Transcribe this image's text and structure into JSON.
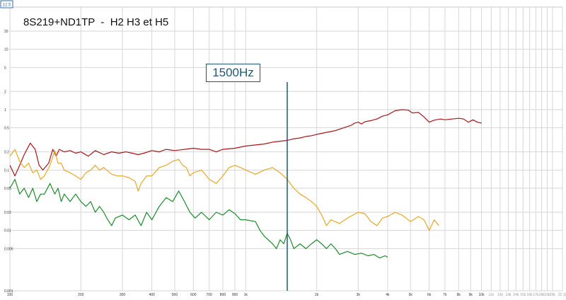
{
  "chart_data": {
    "type": "line",
    "title": "8S219+ND1TP  -  H2 H3 et H5",
    "xlabel": "",
    "ylabel": "",
    "x_scale": "log",
    "y_scale": "log",
    "xlim": [
      100,
      22050
    ],
    "ylim": [
      0.001,
      50
    ],
    "corner_label": "12.5",
    "x_ticks": [
      {
        "v": 100,
        "t": "100"
      },
      {
        "v": 200,
        "t": "200"
      },
      {
        "v": 300,
        "t": "300"
      },
      {
        "v": 400,
        "t": "400"
      },
      {
        "v": 500,
        "t": "500"
      },
      {
        "v": 600,
        "t": "600"
      },
      {
        "v": 700,
        "t": "700"
      },
      {
        "v": 800,
        "t": "800"
      },
      {
        "v": 900,
        "t": "900"
      },
      {
        "v": 1000,
        "t": "1k"
      },
      {
        "v": 2000,
        "t": "2k"
      },
      {
        "v": 3000,
        "t": "3k"
      },
      {
        "v": 4000,
        "t": "4k"
      },
      {
        "v": 5000,
        "t": "5k"
      },
      {
        "v": 6000,
        "t": "6k"
      },
      {
        "v": 7000,
        "t": "7k"
      },
      {
        "v": 8000,
        "t": "8k"
      },
      {
        "v": 9000,
        "t": "9k"
      },
      {
        "v": 10000,
        "t": "10k"
      },
      {
        "v": 11000,
        "t": "11k"
      },
      {
        "v": 12000,
        "t": "12k"
      },
      {
        "v": 13000,
        "t": "13k"
      },
      {
        "v": 14000,
        "t": "14k"
      },
      {
        "v": 15000,
        "t": "15k"
      },
      {
        "v": 16000,
        "t": "16k"
      },
      {
        "v": 17000,
        "t": "17k"
      },
      {
        "v": 18000,
        "t": "18k"
      },
      {
        "v": 19000,
        "t": "19k"
      },
      {
        "v": 20000,
        "t": "20k"
      },
      {
        "v": 22050,
        "t": "22.1k"
      }
    ],
    "y_ticks": [
      {
        "v": 20,
        "t": "20"
      },
      {
        "v": 10,
        "t": "10"
      },
      {
        "v": 5,
        "t": "5"
      },
      {
        "v": 2,
        "t": "2"
      },
      {
        "v": 1,
        "t": "1"
      },
      {
        "v": 0.5,
        "t": "0.5"
      },
      {
        "v": 0.2,
        "t": "0.2"
      },
      {
        "v": 0.1,
        "t": "0.1"
      },
      {
        "v": 0.05,
        "t": "0.05"
      },
      {
        "v": 0.02,
        "t": "0.02"
      },
      {
        "v": 0.01,
        "t": "0.01"
      },
      {
        "v": 0.005,
        "t": "0.005"
      },
      {
        "v": 0.001,
        "t": "0.001"
      }
    ],
    "grid": true,
    "annotation": {
      "label": "1500Hz",
      "x": 1500
    },
    "series": [
      {
        "color": "#a8161c",
        "points": [
          [
            100,
            0.12
          ],
          [
            105,
            0.08
          ],
          [
            110,
            0.12
          ],
          [
            115,
            0.18
          ],
          [
            122,
            0.28
          ],
          [
            128,
            0.22
          ],
          [
            133,
            0.12
          ],
          [
            138,
            0.1
          ],
          [
            146,
            0.13
          ],
          [
            152,
            0.22
          ],
          [
            157,
            0.17
          ],
          [
            162,
            0.22
          ],
          [
            170,
            0.2
          ],
          [
            180,
            0.21
          ],
          [
            190,
            0.19
          ],
          [
            200,
            0.2
          ],
          [
            215,
            0.17
          ],
          [
            230,
            0.21
          ],
          [
            250,
            0.18
          ],
          [
            270,
            0.2
          ],
          [
            290,
            0.19
          ],
          [
            310,
            0.2
          ],
          [
            330,
            0.19
          ],
          [
            350,
            0.18
          ],
          [
            370,
            0.19
          ],
          [
            400,
            0.21
          ],
          [
            430,
            0.2
          ],
          [
            460,
            0.22
          ],
          [
            500,
            0.21
          ],
          [
            550,
            0.22
          ],
          [
            600,
            0.23
          ],
          [
            650,
            0.22
          ],
          [
            700,
            0.22
          ],
          [
            750,
            0.2
          ],
          [
            800,
            0.22
          ],
          [
            900,
            0.23
          ],
          [
            1000,
            0.25
          ],
          [
            1100,
            0.26
          ],
          [
            1200,
            0.27
          ],
          [
            1300,
            0.29
          ],
          [
            1400,
            0.3
          ],
          [
            1500,
            0.31
          ],
          [
            1600,
            0.33
          ],
          [
            1700,
            0.34
          ],
          [
            1800,
            0.36
          ],
          [
            1900,
            0.37
          ],
          [
            2000,
            0.39
          ],
          [
            2200,
            0.42
          ],
          [
            2400,
            0.45
          ],
          [
            2600,
            0.5
          ],
          [
            2800,
            0.55
          ],
          [
            2900,
            0.6
          ],
          [
            3000,
            0.62
          ],
          [
            3100,
            0.58
          ],
          [
            3200,
            0.63
          ],
          [
            3400,
            0.66
          ],
          [
            3600,
            0.7
          ],
          [
            3800,
            0.78
          ],
          [
            4000,
            0.82
          ],
          [
            4300,
            0.96
          ],
          [
            4600,
            1.0
          ],
          [
            4900,
            0.98
          ],
          [
            5100,
            0.88
          ],
          [
            5400,
            0.9
          ],
          [
            5700,
            0.76
          ],
          [
            6000,
            0.62
          ],
          [
            6300,
            0.67
          ],
          [
            6700,
            0.7
          ],
          [
            7000,
            0.68
          ],
          [
            7500,
            0.7
          ],
          [
            8000,
            0.72
          ],
          [
            8400,
            0.7
          ],
          [
            8800,
            0.62
          ],
          [
            9200,
            0.68
          ],
          [
            9600,
            0.62
          ],
          [
            10000,
            0.6
          ]
        ]
      },
      {
        "color": "#e6a92c",
        "points": [
          [
            100,
            0.17
          ],
          [
            105,
            0.22
          ],
          [
            110,
            0.14
          ],
          [
            115,
            0.11
          ],
          [
            120,
            0.13
          ],
          [
            125,
            0.09
          ],
          [
            130,
            0.1
          ],
          [
            135,
            0.07
          ],
          [
            140,
            0.08
          ],
          [
            148,
            0.12
          ],
          [
            155,
            0.21
          ],
          [
            160,
            0.13
          ],
          [
            165,
            0.13
          ],
          [
            170,
            0.1
          ],
          [
            180,
            0.09
          ],
          [
            190,
            0.08
          ],
          [
            200,
            0.07
          ],
          [
            210,
            0.09
          ],
          [
            220,
            0.1
          ],
          [
            230,
            0.12
          ],
          [
            240,
            0.1
          ],
          [
            250,
            0.11
          ],
          [
            270,
            0.085
          ],
          [
            285,
            0.08
          ],
          [
            300,
            0.08
          ],
          [
            320,
            0.075
          ],
          [
            340,
            0.065
          ],
          [
            350,
            0.045
          ],
          [
            360,
            0.06
          ],
          [
            380,
            0.08
          ],
          [
            400,
            0.08
          ],
          [
            430,
            0.11
          ],
          [
            460,
            0.12
          ],
          [
            490,
            0.14
          ],
          [
            520,
            0.15
          ],
          [
            540,
            0.12
          ],
          [
            560,
            0.11
          ],
          [
            580,
            0.08
          ],
          [
            600,
            0.09
          ],
          [
            650,
            0.1
          ],
          [
            700,
            0.07
          ],
          [
            750,
            0.06
          ],
          [
            800,
            0.08
          ],
          [
            850,
            0.11
          ],
          [
            900,
            0.12
          ],
          [
            950,
            0.11
          ],
          [
            1000,
            0.1
          ],
          [
            1100,
            0.085
          ],
          [
            1200,
            0.1
          ],
          [
            1300,
            0.11
          ],
          [
            1400,
            0.09
          ],
          [
            1500,
            0.07
          ],
          [
            1600,
            0.05
          ],
          [
            1700,
            0.04
          ],
          [
            1800,
            0.035
          ],
          [
            1900,
            0.03
          ],
          [
            2000,
            0.025
          ],
          [
            2100,
            0.018
          ],
          [
            2200,
            0.012
          ],
          [
            2300,
            0.015
          ],
          [
            2500,
            0.013
          ],
          [
            2700,
            0.016
          ],
          [
            3000,
            0.02
          ],
          [
            3200,
            0.019
          ],
          [
            3400,
            0.014
          ],
          [
            3600,
            0.012
          ],
          [
            3800,
            0.016
          ],
          [
            4000,
            0.017
          ],
          [
            4300,
            0.02
          ],
          [
            4600,
            0.018
          ],
          [
            5000,
            0.014
          ],
          [
            5400,
            0.017
          ],
          [
            5700,
            0.015
          ],
          [
            6000,
            0.01
          ],
          [
            6300,
            0.015
          ],
          [
            6600,
            0.012
          ]
        ]
      },
      {
        "color": "#1f8a2e",
        "points": [
          [
            100,
            0.05
          ],
          [
            105,
            0.07
          ],
          [
            110,
            0.04
          ],
          [
            115,
            0.05
          ],
          [
            120,
            0.035
          ],
          [
            125,
            0.05
          ],
          [
            130,
            0.03
          ],
          [
            135,
            0.04
          ],
          [
            140,
            0.04
          ],
          [
            148,
            0.06
          ],
          [
            155,
            0.04
          ],
          [
            160,
            0.05
          ],
          [
            165,
            0.03
          ],
          [
            170,
            0.04
          ],
          [
            180,
            0.03
          ],
          [
            190,
            0.04
          ],
          [
            200,
            0.03
          ],
          [
            210,
            0.025
          ],
          [
            220,
            0.03
          ],
          [
            230,
            0.02
          ],
          [
            240,
            0.025
          ],
          [
            250,
            0.02
          ],
          [
            260,
            0.015
          ],
          [
            270,
            0.012
          ],
          [
            280,
            0.016
          ],
          [
            300,
            0.018
          ],
          [
            320,
            0.015
          ],
          [
            340,
            0.018
          ],
          [
            360,
            0.012
          ],
          [
            380,
            0.02
          ],
          [
            400,
            0.015
          ],
          [
            430,
            0.025
          ],
          [
            460,
            0.035
          ],
          [
            490,
            0.03
          ],
          [
            520,
            0.045
          ],
          [
            550,
            0.03
          ],
          [
            580,
            0.02
          ],
          [
            610,
            0.016
          ],
          [
            650,
            0.02
          ],
          [
            700,
            0.015
          ],
          [
            750,
            0.02
          ],
          [
            800,
            0.018
          ],
          [
            850,
            0.022
          ],
          [
            900,
            0.019
          ],
          [
            950,
            0.015
          ],
          [
            1000,
            0.015
          ],
          [
            1100,
            0.014
          ],
          [
            1150,
            0.01
          ],
          [
            1200,
            0.008
          ],
          [
            1300,
            0.006
          ],
          [
            1350,
            0.005
          ],
          [
            1400,
            0.007
          ],
          [
            1450,
            0.006
          ],
          [
            1500,
            0.009
          ],
          [
            1550,
            0.007
          ],
          [
            1600,
            0.005
          ],
          [
            1700,
            0.006
          ],
          [
            1800,
            0.005
          ],
          [
            1900,
            0.006
          ],
          [
            2000,
            0.007
          ],
          [
            2100,
            0.006
          ],
          [
            2200,
            0.005
          ],
          [
            2300,
            0.006
          ],
          [
            2400,
            0.005
          ],
          [
            2500,
            0.004
          ],
          [
            2700,
            0.0045
          ],
          [
            2900,
            0.004
          ],
          [
            3100,
            0.0042
          ],
          [
            3300,
            0.0038
          ],
          [
            3500,
            0.004
          ],
          [
            3700,
            0.0035
          ],
          [
            3900,
            0.0038
          ],
          [
            4000,
            0.0036
          ]
        ]
      }
    ]
  }
}
